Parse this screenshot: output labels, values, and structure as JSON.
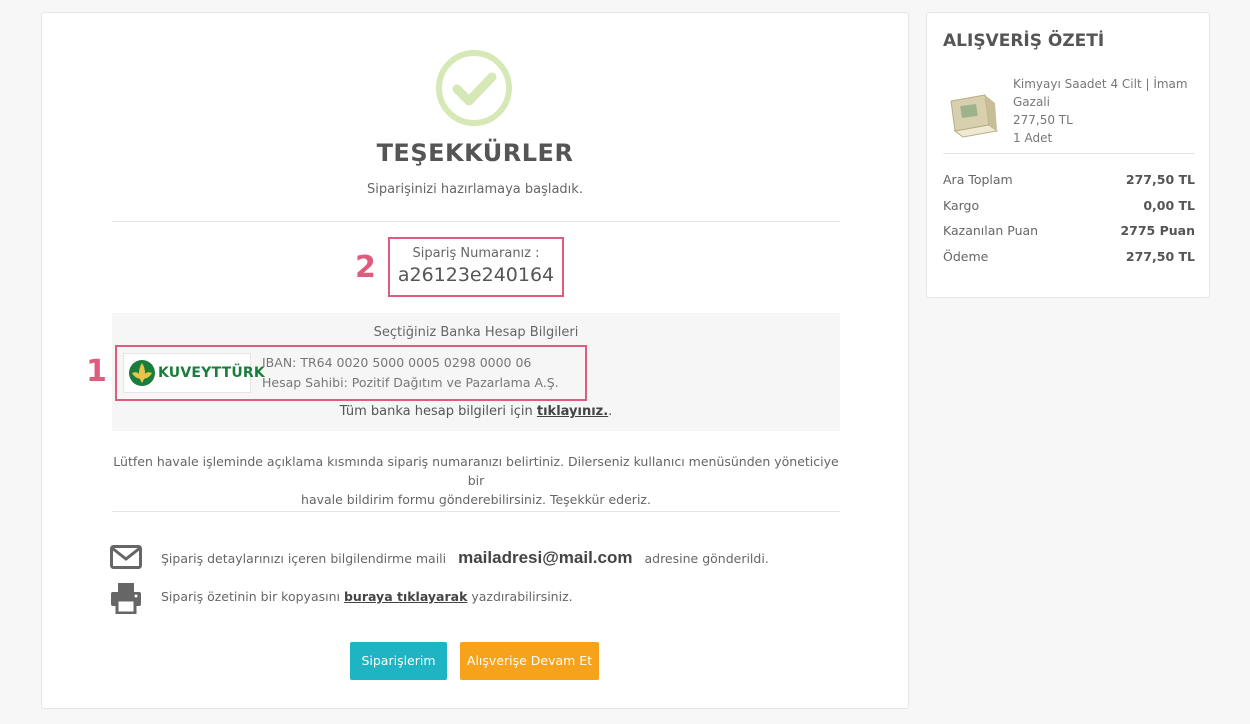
{
  "confirmation": {
    "title": "TEŞEKKÜRLER",
    "subtitle": "Siparişinizi hazırlamaya başladık."
  },
  "order": {
    "label": "Sipariş Numaranız :",
    "number": "a26123e240164"
  },
  "markers": {
    "bank": "1",
    "order": "2"
  },
  "bank": {
    "heading": "Seçtiğiniz Banka Hesap Bilgileri",
    "logo_text": "KUVEYTTÜRK",
    "iban": "IBAN: TR64 0020 5000 0005 0298 0000 06",
    "holder": "Hesap Sahibi: Pozitif Dağıtım ve Pazarlama A.Ş.",
    "all_prefix": "Tüm banka hesap bilgileri için",
    "all_link": "tıklayınız.",
    "all_suffix": "."
  },
  "note": {
    "line1": "Lütfen havale işleminde açıklama kısmında sipariş numaranızı belirtiniz. Dilerseniz kullanıcı menüsünden yöneticiye bir",
    "line2": "havale bildirim formu gönderebilirsiniz. Teşekkür ederiz."
  },
  "email_info": {
    "prefix": "Şipariş detaylarınızı içeren bilgilendirme maili",
    "email": "mailadresi@mail.com",
    "suffix": "adresine gönderildi.",
    "icon": "envelope-icon"
  },
  "print_info": {
    "prefix": "Sipariş özetinin bir kopyasını",
    "link": "buraya tıklayarak",
    "suffix": "yazdırabilirsiniz.",
    "icon": "printer-icon"
  },
  "buttons": {
    "orders": "Siparişlerim",
    "continue": "Alışverişe Devam Et"
  },
  "summary": {
    "title": "ALIŞVERİŞ ÖZETİ",
    "product": {
      "name": "Kimyayı Saadet 4 Cilt | İmam Gazali",
      "price": "277,50 TL",
      "qty": "1 Adet"
    },
    "rows": [
      {
        "label": "Ara Toplam",
        "value": "277,50 TL"
      },
      {
        "label": "Kargo",
        "value": "0,00 TL"
      },
      {
        "label": "Kazanılan Puan",
        "value": "2775 Puan"
      },
      {
        "label": "Ödeme",
        "value": "277,50 TL"
      }
    ]
  },
  "colors": {
    "accent_blue": "#1eb4c3",
    "accent_orange": "#f7a21b",
    "highlight": "#e05c7f",
    "check": "#d6e8b6"
  }
}
